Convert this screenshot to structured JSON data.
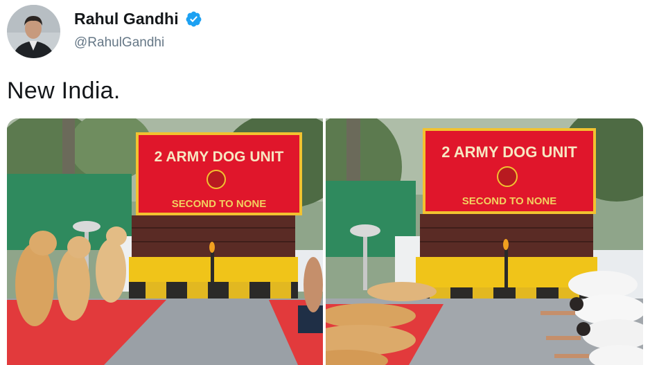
{
  "tweet": {
    "author_name": "Rahul Gandhi",
    "author_handle": "@RahulGandhi",
    "text": "New India.",
    "verified_icon": "verified-badge-icon"
  },
  "media": {
    "left_photo": {
      "sign_title": "2 ARMY DOG UNIT",
      "sign_motto": "SECOND TO NONE"
    },
    "right_photo": {
      "sign_title": "2 ARMY DOG UNIT",
      "sign_motto": "SECOND TO NONE"
    }
  },
  "colors": {
    "sign_red": "#e0162b",
    "sign_gold": "#f2c230",
    "carpet_red": "#e23a3c",
    "verified_blue": "#1da1f2"
  }
}
